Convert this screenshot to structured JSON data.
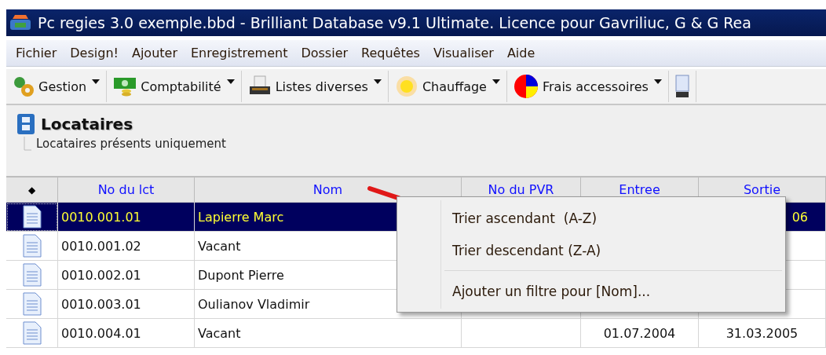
{
  "window": {
    "title": "Pc regies 3.0 exemple.bbd - Brilliant Database v9.1 Ultimate. Licence pour Gavriliuc, G & G Rea"
  },
  "menu": [
    "Fichier",
    "Design!",
    "Ajouter",
    "Enregistrement",
    "Dossier",
    "Requêtes",
    "Visualiser",
    "Aide"
  ],
  "toolbar": [
    {
      "label": "Gestion",
      "kind": "gears"
    },
    {
      "label": "Comptabilité",
      "kind": "money"
    },
    {
      "label": "Listes diverses",
      "kind": "printer"
    },
    {
      "label": "Chauffage",
      "kind": "sun"
    },
    {
      "label": "Frais accessoires",
      "kind": "pie"
    },
    {
      "kind": "file"
    }
  ],
  "view": {
    "title": "Locataires",
    "filter": "Locataires présents uniquement"
  },
  "table": {
    "marker_header": "◆",
    "columns": [
      "No du lct",
      "Nom",
      "No du PVR",
      "Entree",
      "Sortie"
    ],
    "rows": [
      {
        "selected": true,
        "cells": [
          "0010.001.01",
          "Lapierre Marc",
          "",
          "",
          "06"
        ]
      },
      {
        "selected": false,
        "cells": [
          "0010.001.02",
          "Vacant",
          "",
          "",
          ""
        ]
      },
      {
        "selected": false,
        "cells": [
          "0010.002.01",
          "Dupont Pierre",
          "",
          "",
          ""
        ]
      },
      {
        "selected": false,
        "cells": [
          "0010.003.01",
          "Oulianov Vladimir",
          "",
          "",
          ""
        ]
      },
      {
        "selected": false,
        "cells": [
          "0010.004.01",
          "Vacant",
          "",
          "01.07.2004",
          "31.03.2005"
        ]
      }
    ]
  },
  "context_menu": [
    {
      "label": "Trier ascendant  (A-Z)",
      "kind": "item"
    },
    {
      "label": "Trier descendant (Z-A)",
      "kind": "item"
    },
    {
      "kind": "separator"
    },
    {
      "label": "Ajouter un filtre pour [Nom]...",
      "kind": "item"
    }
  ]
}
